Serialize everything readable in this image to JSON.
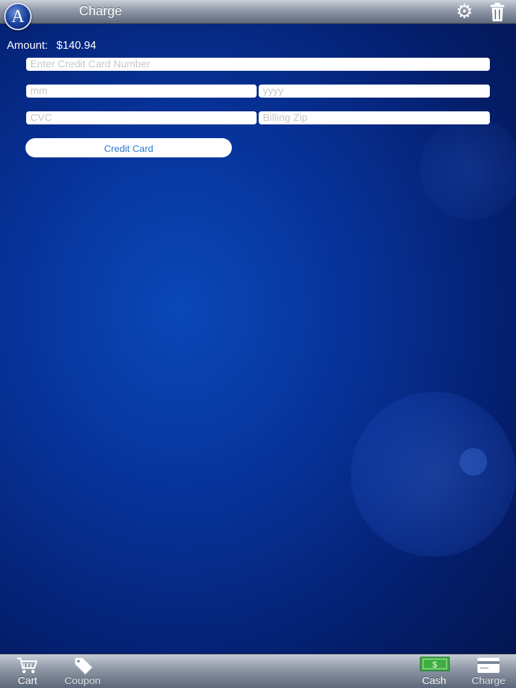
{
  "header": {
    "logo_letter": "A",
    "title": "Charge",
    "settings_icon": "gear-icon",
    "delete_icon": "trash-icon"
  },
  "amount": {
    "label": "Amount:",
    "value": "$140.94"
  },
  "form": {
    "card_number_placeholder": "Enter Credit Card Number",
    "month_placeholder": "mm",
    "year_placeholder": "yyyy",
    "cvc_placeholder": "CVC",
    "zip_placeholder": "Billing Zip",
    "submit_label": "Credit Card"
  },
  "tabbar": {
    "cart_label": "Cart",
    "coupon_label": "Coupon",
    "cash_label": "Cash",
    "charge_label": "Charge"
  },
  "colors": {
    "background": "#07339a",
    "button_text": "#2a7bd0",
    "cash_icon": "#3fae3f"
  }
}
